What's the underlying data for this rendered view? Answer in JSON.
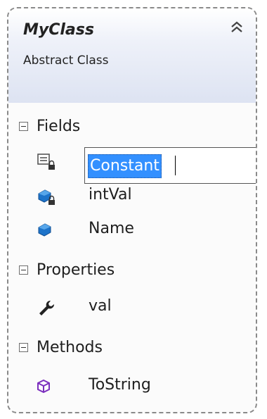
{
  "class": {
    "name": "MyClass",
    "kind": "Abstract Class"
  },
  "sections": {
    "fields": {
      "label": "Fields",
      "items": [
        {
          "name": "Constant",
          "icon": "constant-field-icon",
          "editing": true
        },
        {
          "name": "intVal",
          "icon": "private-field-icon"
        },
        {
          "name": "Name",
          "icon": "public-field-icon"
        }
      ]
    },
    "properties": {
      "label": "Properties",
      "items": [
        {
          "name": "val",
          "icon": "property-wrench-icon"
        }
      ]
    },
    "methods": {
      "label": "Methods",
      "items": [
        {
          "name": "ToString",
          "icon": "method-cube-icon"
        }
      ]
    }
  },
  "colors": {
    "header_gradient_end": "#dde3f2",
    "selection": "#3390ff",
    "field_icon": "#1d73c9",
    "method_icon": "#7b2fbe"
  }
}
